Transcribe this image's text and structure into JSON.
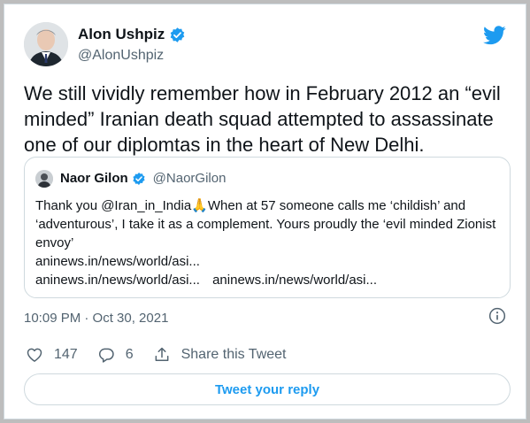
{
  "author": {
    "name": "Alon Ushpiz",
    "handle": "@AlonUshpiz",
    "verified": true
  },
  "tweet": {
    "text": "We still vividly remember how in February 2012 an “evil minded” Iranian death squad attempted to assassinate one of our diplomtas in the heart of New Delhi."
  },
  "quoted": {
    "name": "Naor Gilon",
    "handle": "@NaorGilon",
    "text_before_emoji": "Thank you @Iran_in_India",
    "emoji": "🙏",
    "text_after_emoji": "When at 57 someone calls me ‘childish’ and ‘adventurous’, I take it as a complement. Yours proudly the ‘evil minded Zionist envoy’",
    "link1": "aninews.in/news/world/asi...",
    "link2": "aninews.in/news/world/asi...",
    "link3": "aninews.in/news/world/asi..."
  },
  "meta": {
    "timestamp": "10:09 PM · Oct 30, 2021"
  },
  "actions": {
    "likes": "147",
    "replies": "6",
    "share_label": "Share this Tweet"
  },
  "reply_button": "Tweet your reply",
  "icons": {
    "brand": "twitter-bird-icon",
    "verified": "verified-badge-icon",
    "like": "heart-icon",
    "reply": "reply-bubble-icon",
    "share": "share-icon",
    "info": "info-icon"
  },
  "colors": {
    "accent": "#1d9bf0",
    "muted": "#536471",
    "text": "#0f1419",
    "border": "#cfd9de"
  }
}
